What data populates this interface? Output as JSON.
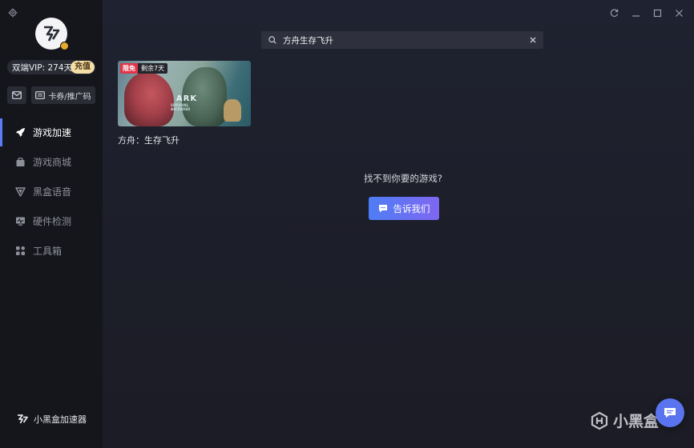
{
  "sidebar": {
    "vip_text": "双端VIP: 274天",
    "recharge_label": "充值",
    "coupon_label": "卡券/推广码",
    "nav": [
      {
        "label": "游戏加速",
        "icon": "rocket-icon",
        "active": true
      },
      {
        "label": "游戏商城",
        "icon": "bag-icon",
        "active": false
      },
      {
        "label": "黑盒语音",
        "icon": "voice-icon",
        "active": false
      },
      {
        "label": "硬件检测",
        "icon": "monitor-icon",
        "active": false
      },
      {
        "label": "工具箱",
        "icon": "grid-icon",
        "active": false
      }
    ],
    "brand_name": "小黑盒加速器"
  },
  "search": {
    "value": "方舟生存飞升"
  },
  "results": [
    {
      "title": "方舟：生存飞升",
      "badge_free": "限免",
      "badge_days": "剩余7天",
      "art_logo": "ARK",
      "art_subtitle": "SURVIVAL ASCENDED"
    }
  ],
  "not_found": {
    "question": "找不到你要的游戏?",
    "button_label": "告诉我们"
  },
  "watermark_text": "小黑盒",
  "colors": {
    "accent": "#5b7cf7",
    "badge_red": "#e2334a",
    "recharge_gold": "#f6dfa6"
  }
}
